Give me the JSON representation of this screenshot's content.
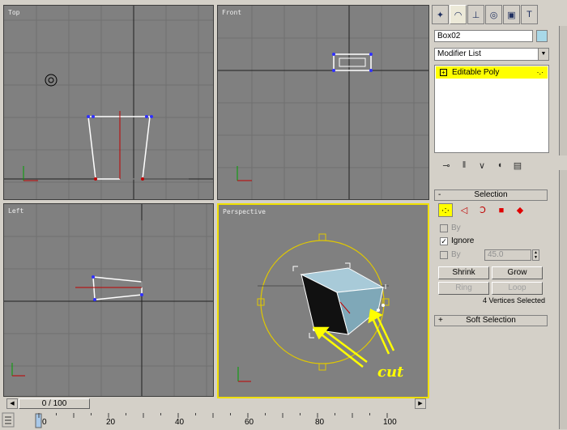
{
  "viewports": {
    "top": "Top",
    "front": "Front",
    "left": "Left",
    "perspective": "Perspective"
  },
  "annotation": {
    "text": "cut",
    "color": "#ffff00"
  },
  "panel": {
    "tabs": [
      "create-icon",
      "modify-icon",
      "hierarchy-icon",
      "motion-icon",
      "display-icon",
      "utilities-icon"
    ],
    "object_name": "Box02",
    "object_color": "#a8d8e8",
    "modifier_list": "Modifier List",
    "stack_item": "Editable Poly",
    "selection_rollout": {
      "title": "Selection",
      "by_vertex": "By",
      "ignore_backfacing": "Ignore",
      "by_angle": "By",
      "angle_value": "45.0",
      "shrink": "Shrink",
      "grow": "Grow",
      "ring": "Ring",
      "loop": "Loop",
      "status": "4 Vertices Selected"
    },
    "soft_selection": "Soft Selection"
  },
  "timeline": {
    "frame": "0 / 100",
    "ticks": [
      "0",
      "20",
      "40",
      "60",
      "80",
      "100"
    ]
  },
  "colors": {
    "viewport_bg": "#808080",
    "active_border": "#f0e000",
    "selection_highlight": "#ffff00"
  }
}
